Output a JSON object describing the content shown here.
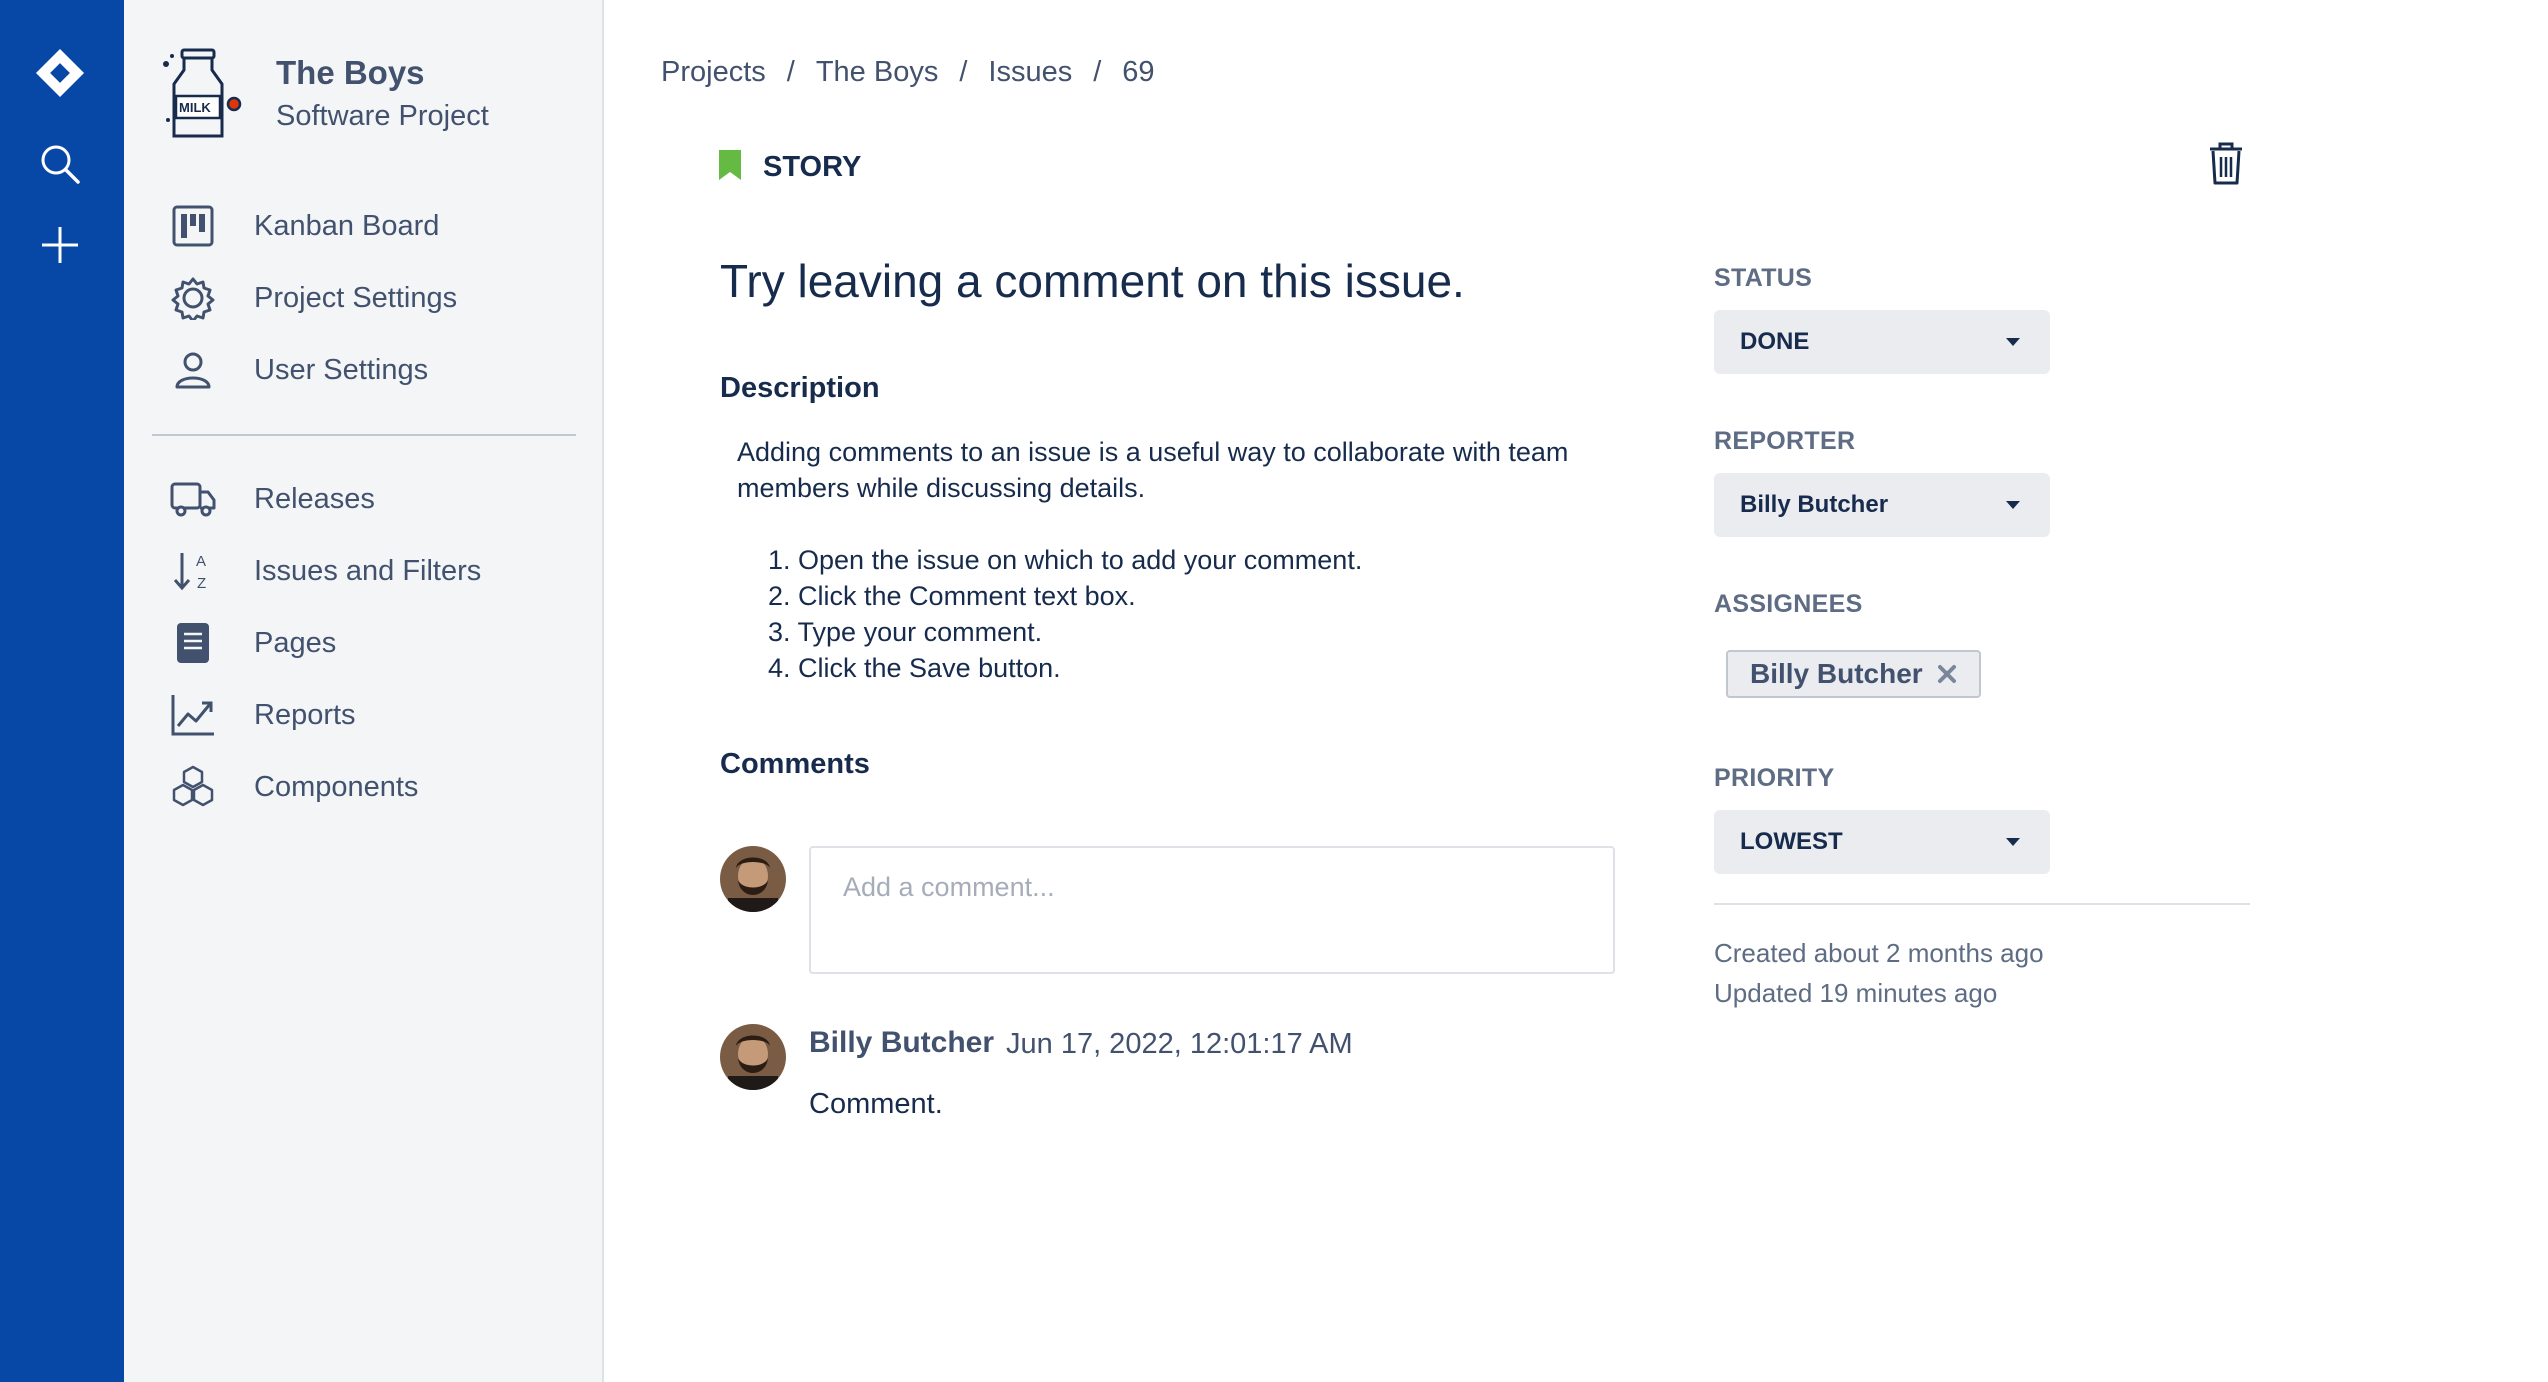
{
  "sidebar": {
    "project_name": "The Boys",
    "project_type": "Software Project",
    "logo_text": "MILK",
    "items": [
      {
        "label": "Kanban Board",
        "icon": "board-icon"
      },
      {
        "label": "Project Settings",
        "icon": "gear-icon"
      },
      {
        "label": "User Settings",
        "icon": "user-icon"
      },
      {
        "label": "Releases",
        "icon": "truck-icon"
      },
      {
        "label": "Issues and Filters",
        "icon": "sort-az-icon"
      },
      {
        "label": "Pages",
        "icon": "page-icon"
      },
      {
        "label": "Reports",
        "icon": "chart-icon"
      },
      {
        "label": "Components",
        "icon": "cubes-icon"
      }
    ]
  },
  "breadcrumb": [
    "Projects",
    "The Boys",
    "Issues",
    "69"
  ],
  "breadcrumb_sep": "/",
  "issue": {
    "type": "STORY",
    "title": "Try leaving a comment on this issue.",
    "description_heading": "Description",
    "description": "Adding comments to an issue is a useful way to collaborate with team members while discussing details.",
    "steps": [
      "1. Open the issue on which to add your comment.",
      "2. Click the Comment text box.",
      "3. Type your comment.",
      "4. Click the Save button."
    ],
    "comments_heading": "Comments",
    "comment_placeholder": "Add a comment...",
    "comments": [
      {
        "author": "Billy Butcher",
        "date": "Jun 17, 2022, 12:01:17 AM",
        "body": "Comment."
      }
    ]
  },
  "fields": {
    "status_label": "STATUS",
    "status_value": "DONE",
    "reporter_label": "REPORTER",
    "reporter_value": "Billy Butcher",
    "assignees_label": "ASSIGNEES",
    "assignees": [
      "Billy Butcher"
    ],
    "priority_label": "PRIORITY",
    "priority_value": "LOWEST",
    "created": "Created about 2 months ago",
    "updated": "Updated 19 minutes ago"
  },
  "colors": {
    "rail": "#0747a6",
    "sidebar_bg": "#f4f5f7",
    "story_green": "#65ba43",
    "text_dark": "#172b4d",
    "text_muted": "#42526e"
  }
}
